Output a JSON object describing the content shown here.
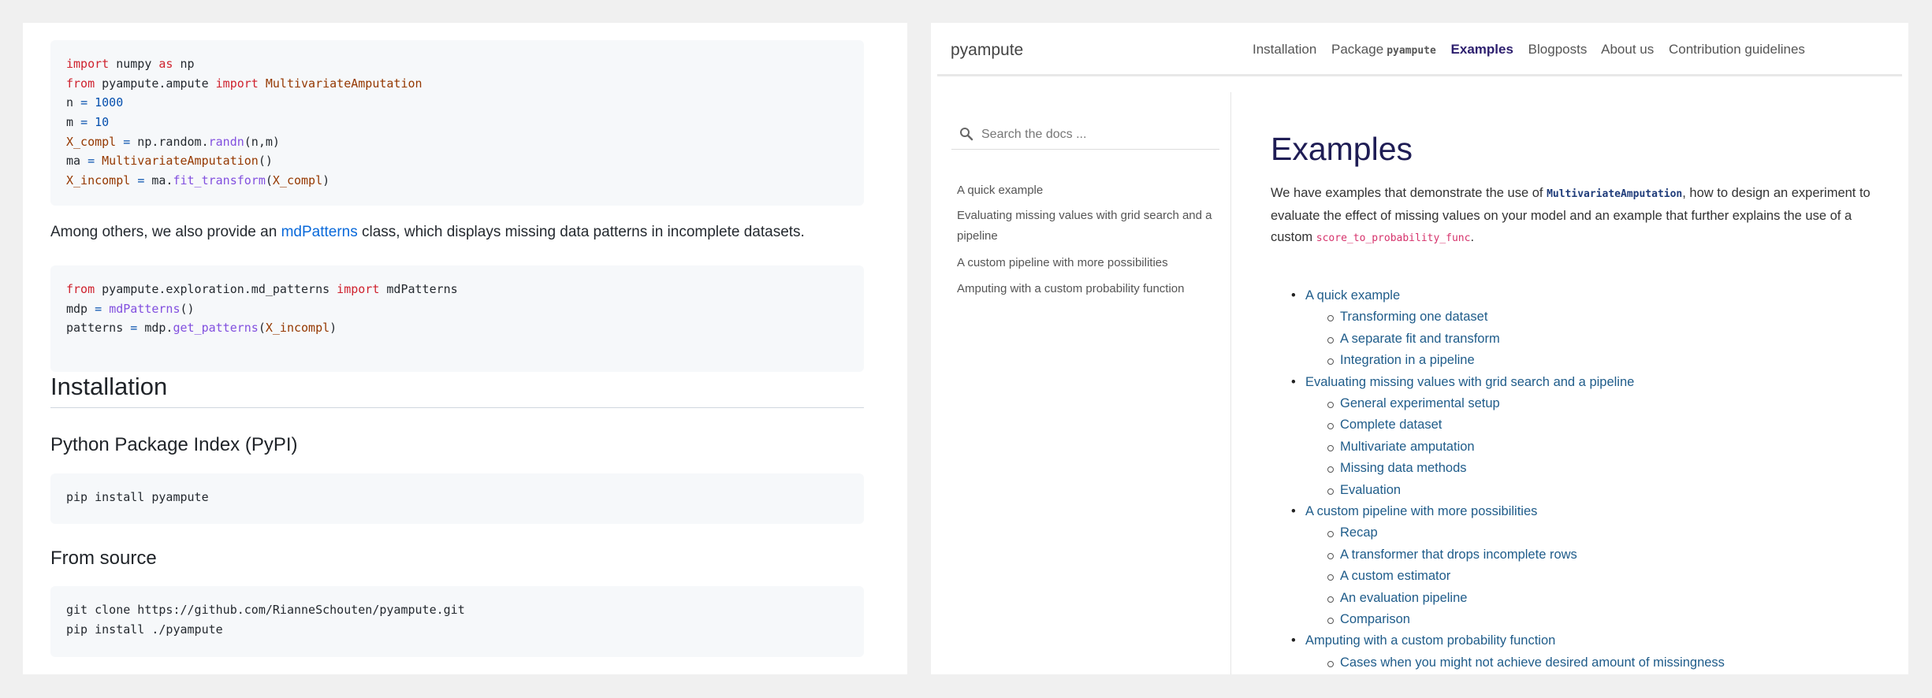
{
  "left": {
    "code1": [
      [
        {
          "t": "import",
          "c": "kw"
        },
        {
          "t": " numpy "
        },
        {
          "t": "as",
          "c": "kw"
        },
        {
          "t": " np"
        }
      ],
      [
        {
          "t": "from",
          "c": "kw"
        },
        {
          "t": " pyampute.ampute "
        },
        {
          "t": "import",
          "c": "kw"
        },
        {
          "t": " "
        },
        {
          "t": "MultivariateAmputation",
          "c": "var"
        }
      ],
      [
        {
          "t": "n "
        },
        {
          "t": "=",
          "c": "num"
        },
        {
          "t": " "
        },
        {
          "t": "1000",
          "c": "num"
        }
      ],
      [
        {
          "t": "m "
        },
        {
          "t": "=",
          "c": "num"
        },
        {
          "t": " "
        },
        {
          "t": "10",
          "c": "num"
        }
      ],
      [
        {
          "t": "X_compl",
          "c": "var"
        },
        {
          "t": " "
        },
        {
          "t": "=",
          "c": "num"
        },
        {
          "t": " np.random."
        },
        {
          "t": "randn",
          "c": "fn"
        },
        {
          "t": "(n,m)"
        }
      ],
      [
        {
          "t": "ma "
        },
        {
          "t": "=",
          "c": "num"
        },
        {
          "t": " "
        },
        {
          "t": "MultivariateAmputation",
          "c": "var"
        },
        {
          "t": "()"
        }
      ],
      [
        {
          "t": "X_incompl",
          "c": "var"
        },
        {
          "t": " "
        },
        {
          "t": "=",
          "c": "num"
        },
        {
          "t": " ma."
        },
        {
          "t": "fit_transform",
          "c": "fn"
        },
        {
          "t": "("
        },
        {
          "t": "X_compl",
          "c": "var"
        },
        {
          "t": ")"
        }
      ]
    ],
    "prose_before": "Among others, we also provide an ",
    "prose_link": "mdPatterns",
    "prose_after": " class, which displays missing data patterns in incomplete datasets.",
    "code2": [
      [
        {
          "t": "from",
          "c": "kw"
        },
        {
          "t": " pyampute.exploration.md_patterns "
        },
        {
          "t": "import",
          "c": "kw"
        },
        {
          "t": " mdPatterns"
        }
      ],
      [
        {
          "t": "mdp "
        },
        {
          "t": "=",
          "c": "num"
        },
        {
          "t": " "
        },
        {
          "t": "mdPatterns",
          "c": "fn"
        },
        {
          "t": "()"
        }
      ],
      [
        {
          "t": "patterns "
        },
        {
          "t": "=",
          "c": "num"
        },
        {
          "t": " mdp."
        },
        {
          "t": "get_patterns",
          "c": "fn"
        },
        {
          "t": "("
        },
        {
          "t": "X_incompl",
          "c": "var"
        },
        {
          "t": ")"
        }
      ]
    ],
    "installation_heading": "Installation",
    "pypi_heading": "Python Package Index (PyPI)",
    "code3": [
      [
        {
          "t": "pip install pyampute"
        }
      ]
    ],
    "source_heading": "From source",
    "code4": [
      [
        {
          "t": "git clone https://github.com/RianneSchouten/pyampute.git"
        }
      ],
      [
        {
          "t": "pip install ./pyampute"
        }
      ]
    ]
  },
  "right": {
    "brand": "pyampute",
    "nav": {
      "installation": "Installation",
      "package_label": "Package",
      "package_code": "pyampute",
      "examples": "Examples",
      "blogposts": "Blogposts",
      "about": "About us",
      "contribution": "Contribution guidelines"
    },
    "search_placeholder": "Search the docs ...",
    "sidebar": [
      "A quick example",
      "Evaluating missing values with grid search and a pipeline",
      "A custom pipeline with more possibilities",
      "Amputing with a custom probability function"
    ],
    "title": "Examples",
    "intro": {
      "p1": "We have examples that demonstrate the use of ",
      "c1": "MultivariateAmputation",
      "p2": ", how to design an experiment to evaluate the effect of missing values on your model and an example that further explains the use of a custom ",
      "c2": "score_to_probability_func",
      "p3": "."
    },
    "toc": [
      {
        "label": "A quick example",
        "children": [
          "Transforming one dataset",
          "A separate fit and transform",
          "Integration in a pipeline"
        ]
      },
      {
        "label": "Evaluating missing values with grid search and a pipeline",
        "children": [
          "General experimental setup",
          "Complete dataset",
          "Multivariate amputation",
          "Missing data methods",
          "Evaluation"
        ]
      },
      {
        "label": "A custom pipeline with more possibilities",
        "children": [
          "Recap",
          "A transformer that drops incomplete rows",
          "A custom estimator",
          "An evaluation pipeline",
          "Comparison"
        ]
      },
      {
        "label": "Amputing with a custom probability function",
        "children": [
          "Cases when you might not achieve desired amount of missingness"
        ]
      }
    ],
    "colors": {
      "accent": "#2d1f6e",
      "link": "#1f5c8a"
    },
    "icons": {
      "search": "search-icon"
    }
  }
}
